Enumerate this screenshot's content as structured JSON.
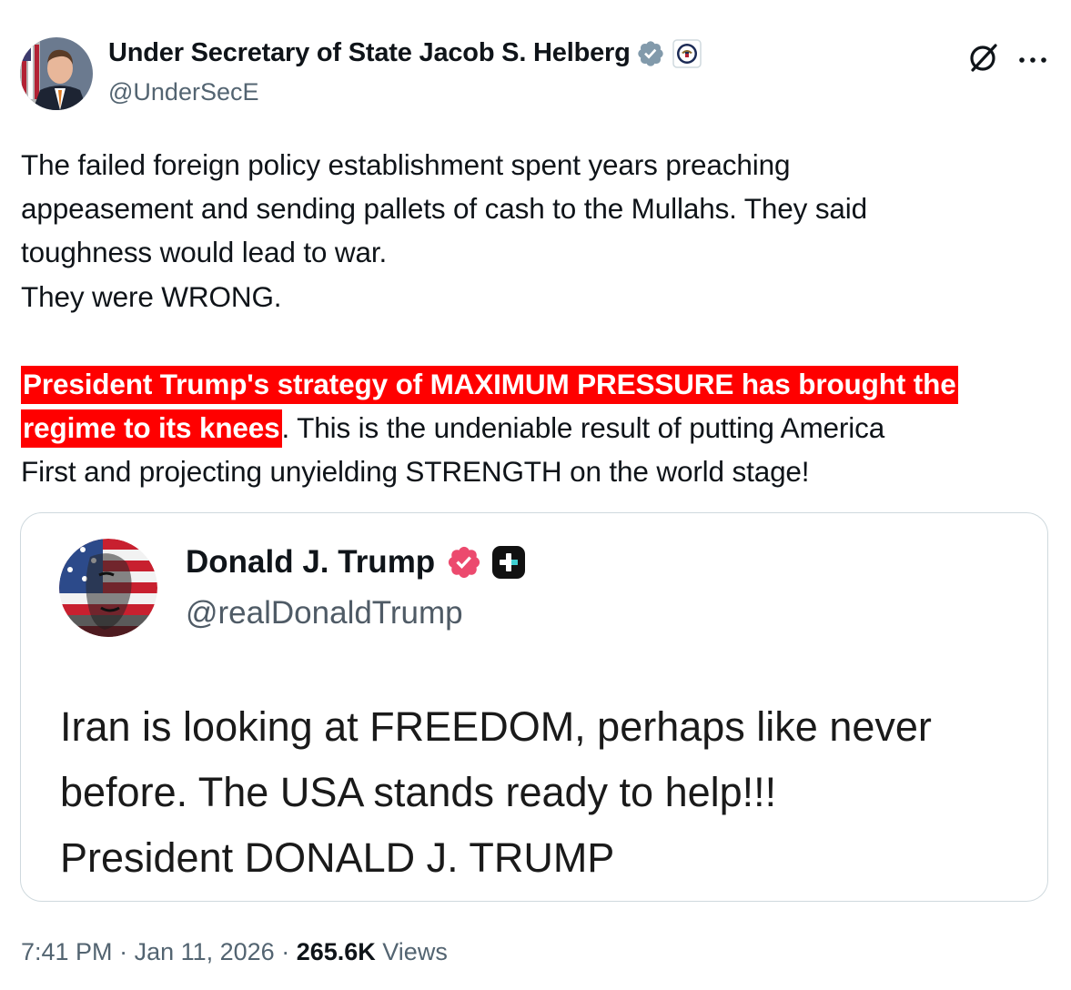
{
  "author": {
    "display_name": "Under Secretary of State Jacob S. Helberg",
    "handle": "@UnderSecE"
  },
  "tweet": {
    "para1_line1": "The failed foreign policy establishment spent years preaching",
    "para1_line2": "appeasement and sending pallets of cash to the Mullahs. They said",
    "para1_line3": "toughness would lead to war.",
    "para1_line4": "They were WRONG.",
    "highlight_line1": "President Trump's strategy of MAXIMUM PRESSURE has brought the",
    "highlight_line2": "regime to its knees",
    "para2_rest_line2": ". This is the undeniable result of putting America",
    "para2_line3": "First and projecting unyielding STRENGTH on the world stage!"
  },
  "quoted": {
    "display_name": "Donald J. Trump",
    "handle": "@realDonaldTrump",
    "line1": "Iran is looking at FREEDOM, perhaps like never",
    "line2": "before. The USA stands ready to help!!!",
    "line3": "President DONALD J. TRUMP"
  },
  "meta": {
    "time": "7:41 PM",
    "sep1": " · ",
    "date": "Jan 11, 2026",
    "sep2": " · ",
    "views_count": "265.6K",
    "views_label": " Views"
  },
  "icons": {
    "verified_badge": "verified-badge-icon",
    "seal": "state-department-seal-icon",
    "grok": "grok-icon",
    "more": "more-icon",
    "quoted_verified": "verified-badge-icon",
    "quoted_platform": "truth-social-icon"
  },
  "colors": {
    "highlight": "#ff0000",
    "verified_gray": "#829aab",
    "quoted_verified_pink": "#ec4a6e",
    "secondary_text": "#536471",
    "border": "#cfd9de"
  }
}
